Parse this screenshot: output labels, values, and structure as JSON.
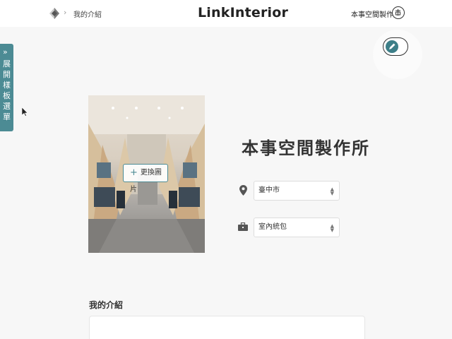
{
  "header": {
    "breadcrumb_sep": "›",
    "breadcrumb": "我的介紹",
    "brand": "LinkInterior",
    "studio_name": "本事空間製作所"
  },
  "drawer": {
    "chevron": "»",
    "label": "展開樣板選單"
  },
  "cover": {
    "change_button": "更換圖片",
    "plus": "+"
  },
  "profile": {
    "title": "本事空間製作所",
    "city": "臺中市",
    "category": "室內統包"
  },
  "about": {
    "label": "我的介紹"
  },
  "icons": {
    "logo": "diamond-logo-icon",
    "location": "map-pin-icon",
    "category": "briefcase-icon",
    "edit_toggle": "pencil-toggle-icon"
  },
  "colors": {
    "accent": "#4c8b94",
    "toggle_knob": "#3d7f88"
  }
}
